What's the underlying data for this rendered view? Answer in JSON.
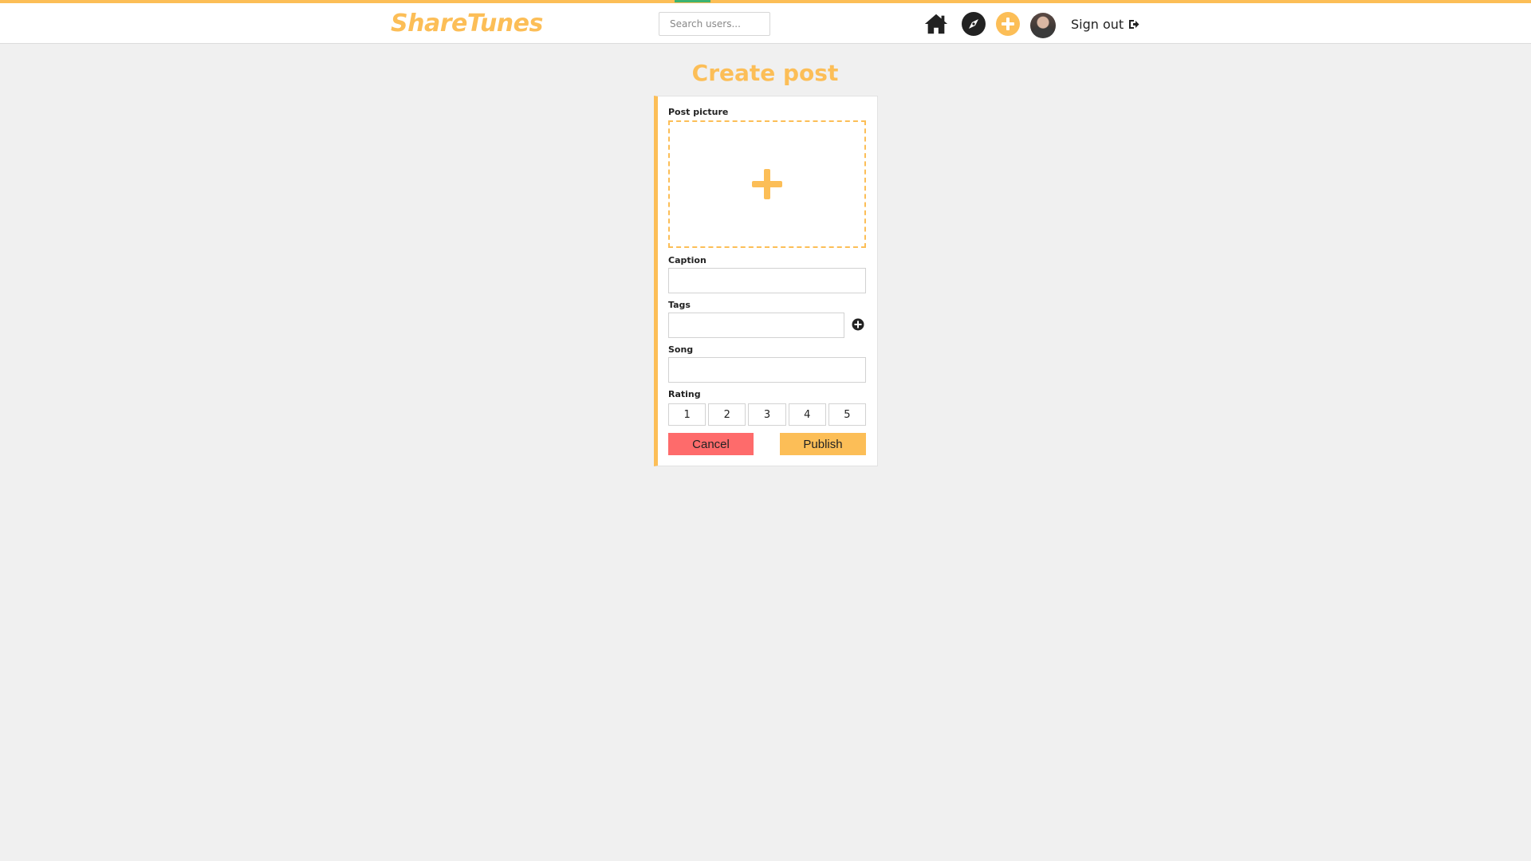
{
  "colors": {
    "accent": "#fcbe57",
    "cancel": "#fe6b6b",
    "background": "#f0f0f0",
    "progress": "#3cb371"
  },
  "header": {
    "logo": "ShareTunes",
    "search": {
      "placeholder": "Search users...",
      "value": ""
    },
    "icons": [
      "home-icon",
      "explore-compass-icon",
      "create-plus-icon",
      "avatar"
    ],
    "signout_label": "Sign out",
    "signout_icon": "sign-out-icon"
  },
  "page": {
    "title": "Create post"
  },
  "form": {
    "picture": {
      "label": "Post picture",
      "icon": "plus-icon"
    },
    "caption": {
      "label": "Caption",
      "value": ""
    },
    "tags": {
      "label": "Tags",
      "value": "",
      "add_icon": "plus-circle-icon"
    },
    "song": {
      "label": "Song",
      "value": ""
    },
    "rating": {
      "label": "Rating",
      "options": [
        "1",
        "2",
        "3",
        "4",
        "5"
      ]
    },
    "cancel_label": "Cancel",
    "publish_label": "Publish"
  }
}
